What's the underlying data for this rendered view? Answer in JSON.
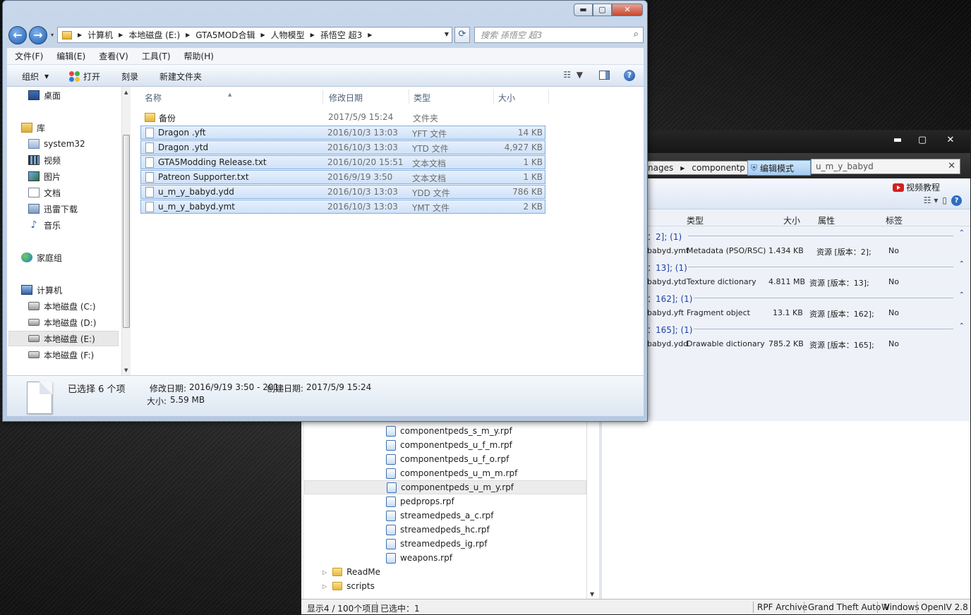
{
  "explorer": {
    "window_buttons": {
      "minimize": "▬",
      "maximize": "▢",
      "close": "✕"
    },
    "nav": {
      "back": "←",
      "forward": "→",
      "history": "▾"
    },
    "breadcrumb": [
      "计算机",
      "本地磁盘 (E:)",
      "GTA5MOD合辑",
      "人物模型",
      "孫悟空 超3"
    ],
    "search_placeholder": "搜索 孫悟空 超3",
    "menu": [
      "文件(F)",
      "编辑(E)",
      "查看(V)",
      "工具(T)",
      "帮助(H)"
    ],
    "commands": {
      "organize": "组织",
      "open": "打开",
      "burn": "刻录",
      "new_folder": "新建文件夹"
    },
    "columns": {
      "name": "名称",
      "modified": "修改日期",
      "type": "类型",
      "size": "大小"
    },
    "nav_pane": {
      "desktop": "桌面",
      "libraries": "库",
      "lib_items": [
        "system32",
        "视频",
        "图片",
        "文档",
        "迅雷下载",
        "音乐"
      ],
      "homegroup": "家庭组",
      "computer": "计算机",
      "drives": [
        "本地磁盘 (C:)",
        "本地磁盘 (D:)",
        "本地磁盘 (E:)",
        "本地磁盘 (F:)"
      ]
    },
    "files": [
      {
        "name": "备份",
        "modified": "2017/5/9 15:24",
        "type": "文件夹",
        "size": "",
        "kind": "folder",
        "selected": false
      },
      {
        "name": "Dragon .yft",
        "modified": "2016/10/3 13:03",
        "type": "YFT 文件",
        "size": "14 KB",
        "kind": "file",
        "selected": true
      },
      {
        "name": "Dragon .ytd",
        "modified": "2016/10/3 13:03",
        "type": "YTD 文件",
        "size": "4,927 KB",
        "kind": "file",
        "selected": true
      },
      {
        "name": "GTA5Modding Release.txt",
        "modified": "2016/10/20 15:51",
        "type": "文本文档",
        "size": "1 KB",
        "kind": "file",
        "selected": true
      },
      {
        "name": "Patreon Supporter.txt",
        "modified": "2016/9/19 3:50",
        "type": "文本文档",
        "size": "1 KB",
        "kind": "file",
        "selected": true
      },
      {
        "name": "u_m_y_babyd.ydd",
        "modified": "2016/10/3 13:03",
        "type": "YDD 文件",
        "size": "786 KB",
        "kind": "file",
        "selected": true
      },
      {
        "name": "u_m_y_babyd.ymt",
        "modified": "2016/10/3 13:03",
        "type": "YMT 文件",
        "size": "2 KB",
        "kind": "file",
        "selected": true
      }
    ],
    "details": {
      "selected": "已选择 6 个项",
      "modified_label": "修改日期:",
      "modified_value": "2016/9/19 3:50 - 201...",
      "created_label": "创建日期:",
      "created_value": "2017/5/9 15:24",
      "size_label": "大小:",
      "size_value": "5.59 MB"
    }
  },
  "openiv": {
    "window_buttons": {
      "minimize": "▬",
      "maximize": "▢",
      "close": "✕"
    },
    "path": [
      "nages",
      "componentp"
    ],
    "edit_mode": "编辑模式",
    "search_value": "u_m_y_babyd",
    "video_tutorial": "视频教程",
    "columns": {
      "type": "类型",
      "size": "大小",
      "attr": "属性",
      "tag": "标签"
    },
    "groups": [
      {
        "label": "：2]; (1)",
        "item": {
          "name": "babyd.ymt",
          "type": "Metadata (PSO/RSC)",
          "size": "1.434 KB",
          "attr": "资源 [版本：2];",
          "tag": "No"
        }
      },
      {
        "label": "：13]; (1)",
        "item": {
          "name": "babyd.ytd",
          "type": "Texture dictionary",
          "size": "4.811 MB",
          "attr": "资源 [版本：13];",
          "tag": "No"
        }
      },
      {
        "label": "：162]; (1)",
        "item": {
          "name": "babyd.yft",
          "type": "Fragment object",
          "size": "13.1 KB",
          "attr": "资源 [版本：162];",
          "tag": "No"
        }
      },
      {
        "label": "：165]; (1)",
        "item": {
          "name": "babyd.ydd",
          "type": "Drawable dictionary",
          "size": "785.2 KB",
          "attr": "资源 [版本：165];",
          "tag": "No"
        }
      }
    ],
    "tree": [
      {
        "label": "componentpeds_s_m_y.rpf",
        "kind": "rpf",
        "selected": false
      },
      {
        "label": "componentpeds_u_f_m.rpf",
        "kind": "rpf",
        "selected": false
      },
      {
        "label": "componentpeds_u_f_o.rpf",
        "kind": "rpf",
        "selected": false
      },
      {
        "label": "componentpeds_u_m_m.rpf",
        "kind": "rpf",
        "selected": false
      },
      {
        "label": "componentpeds_u_m_y.rpf",
        "kind": "rpf",
        "selected": true
      },
      {
        "label": "pedprops.rpf",
        "kind": "rpf",
        "selected": false
      },
      {
        "label": "streamedpeds_a_c.rpf",
        "kind": "rpf",
        "selected": false
      },
      {
        "label": "streamedpeds_hc.rpf",
        "kind": "rpf",
        "selected": false
      },
      {
        "label": "streamedpeds_ig.rpf",
        "kind": "rpf",
        "selected": false
      },
      {
        "label": "weapons.rpf",
        "kind": "rpf",
        "selected": false
      },
      {
        "label": "ReadMe",
        "kind": "folder",
        "selected": false
      },
      {
        "label": "scripts",
        "kind": "folder",
        "selected": false
      }
    ],
    "status": {
      "count": "显示4 / 100个项目",
      "selected": "已选中：1",
      "archive": "RPF Archive",
      "game": "Grand Theft Auto V",
      "platform": "Windows",
      "version": "OpenIV 2.8"
    }
  }
}
